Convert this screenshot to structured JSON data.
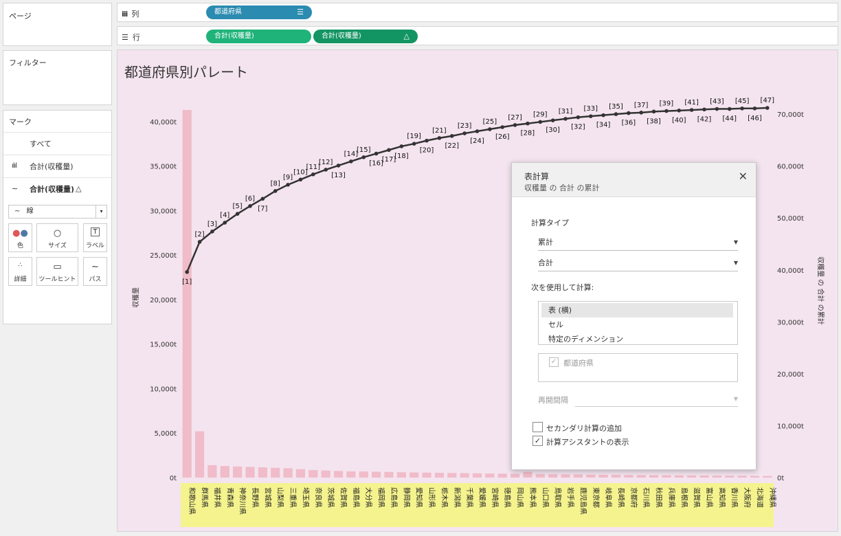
{
  "pages_panel": {
    "title": "ページ"
  },
  "filters_panel": {
    "title": "フィルター"
  },
  "columns_shelf": {
    "label": "列",
    "pill": "都道府県"
  },
  "rows_shelf": {
    "label": "行",
    "pills": [
      "合計(収穫量)",
      "合計(収穫量)"
    ],
    "pill2_icon": "△"
  },
  "marks": {
    "title": "マーク",
    "all": "すべて",
    "row1": "合計(収穫量)",
    "row2": "合計(収穫量)",
    "row2_icon": "△",
    "mark_type": "線",
    "buttons": [
      "色",
      "サイズ",
      "ラベル",
      "詳細",
      "ツールヒント",
      "パス"
    ]
  },
  "viz": {
    "title": "都道府県別パレート",
    "bg_color": "#f4e4ef",
    "bar_color": "#f0bcc9",
    "line_color": "#333333",
    "cat_highlight": "#f5f38e"
  },
  "chart_data": {
    "type": "bar",
    "title": "都道府県別パレート",
    "ylabel": "収穫量",
    "y2label": "収穫量 の 合計 の累計",
    "ylim": [
      0,
      42000
    ],
    "y2lim": [
      0,
      72000
    ],
    "yticks": [
      "0t",
      "5,000t",
      "10,000t",
      "15,000t",
      "20,000t",
      "25,000t",
      "30,000t",
      "35,000t",
      "40,000t"
    ],
    "y2ticks": [
      "0t",
      "10,000t",
      "20,000t",
      "30,000t",
      "40,000t",
      "50,000t",
      "60,000t",
      "70,000t"
    ],
    "categories": [
      "和歌山県",
      "群馬県",
      "福井県",
      "青森県",
      "神奈川県",
      "長野県",
      "宮城県",
      "山梨県",
      "三重県",
      "埼玉県",
      "奈良県",
      "茨城県",
      "佐賀県",
      "福島県",
      "大分県",
      "福岡県",
      "広島県",
      "静岡県",
      "愛知県",
      "山形県",
      "栃木県",
      "新潟県",
      "千葉県",
      "愛媛県",
      "宮崎県",
      "徳島県",
      "岡山県",
      "熊本県",
      "山口県",
      "鳥取県",
      "岩手県",
      "鹿児島県",
      "東京都",
      "岐阜県",
      "長崎県",
      "京都府",
      "石川県",
      "秋田県",
      "兵庫県",
      "島根県",
      "滋賀県",
      "富山県",
      "高知県",
      "香川県",
      "大阪府",
      "北海道",
      "沖縄県"
    ],
    "series": [
      {
        "name": "合計(収穫量)",
        "type": "bar",
        "values": [
          41300,
          5200,
          1400,
          1300,
          1250,
          1200,
          1150,
          1100,
          1050,
          950,
          850,
          800,
          750,
          700,
          680,
          660,
          640,
          600,
          580,
          560,
          540,
          520,
          500,
          480,
          460,
          440,
          420,
          650,
          400,
          380,
          360,
          350,
          330,
          310,
          300,
          290,
          280,
          270,
          260,
          250,
          240,
          230,
          220,
          210,
          200,
          190,
          180
        ]
      },
      {
        "name": "合計(収穫量)",
        "type": "line",
        "values": [
          39600,
          45400,
          47400,
          49100,
          50800,
          52300,
          53700,
          55200,
          56400,
          57400,
          58400,
          59300,
          60100,
          60900,
          61700,
          62400,
          63100,
          63800,
          64300,
          64900,
          65400,
          65800,
          66300,
          66700,
          67100,
          67500,
          67900,
          68200,
          68500,
          68800,
          69100,
          69400,
          69600,
          69800,
          70000,
          70200,
          70300,
          70500,
          70600,
          70700,
          70800,
          70900,
          71000,
          71000,
          71100,
          71100,
          71200
        ]
      }
    ],
    "point_labels": [
      "[1]",
      "[2]",
      "[3]",
      "[4]",
      "[5]",
      "[6]",
      "[7]",
      "[8]",
      "[9]",
      "[10]",
      "[11]",
      "[12]",
      "[13]",
      "[14]",
      "[15]",
      "[16]",
      "[17]",
      "[18]",
      "[19]",
      "[20]",
      "[21]",
      "[22]",
      "[23]",
      "[24]",
      "[25]",
      "[26]",
      "[27]",
      "[28]",
      "[29]",
      "[30]",
      "[31]",
      "[32]",
      "[33]",
      "[34]",
      "[35]",
      "[36]",
      "[37]",
      "[38]",
      "[39]",
      "[40]",
      "[41]",
      "[42]",
      "[43]",
      "[44]",
      "[45]",
      "[46]",
      "[47]"
    ],
    "label_below": [
      1,
      7,
      13,
      16,
      17,
      18,
      20,
      22,
      24,
      26,
      28,
      30,
      32,
      34,
      36,
      38,
      40,
      42,
      44,
      46
    ]
  },
  "dialog": {
    "title": "表計算",
    "subtitle": "収穫量 の 合計 の累計",
    "calc_type_label": "計算タイプ",
    "calc_type": "累計",
    "aggregation": "合計",
    "compute_using_label": "次を使用して計算:",
    "options": [
      "表 (横)",
      "セル",
      "特定のディメンション"
    ],
    "selected_option": "表 (横)",
    "dimension": "都道府県",
    "restart_label": "再開間隔",
    "secondary_label": "セカンダリ計算の追加",
    "assistant_label": "計算アシスタントの表示",
    "assistant_checked": true
  }
}
